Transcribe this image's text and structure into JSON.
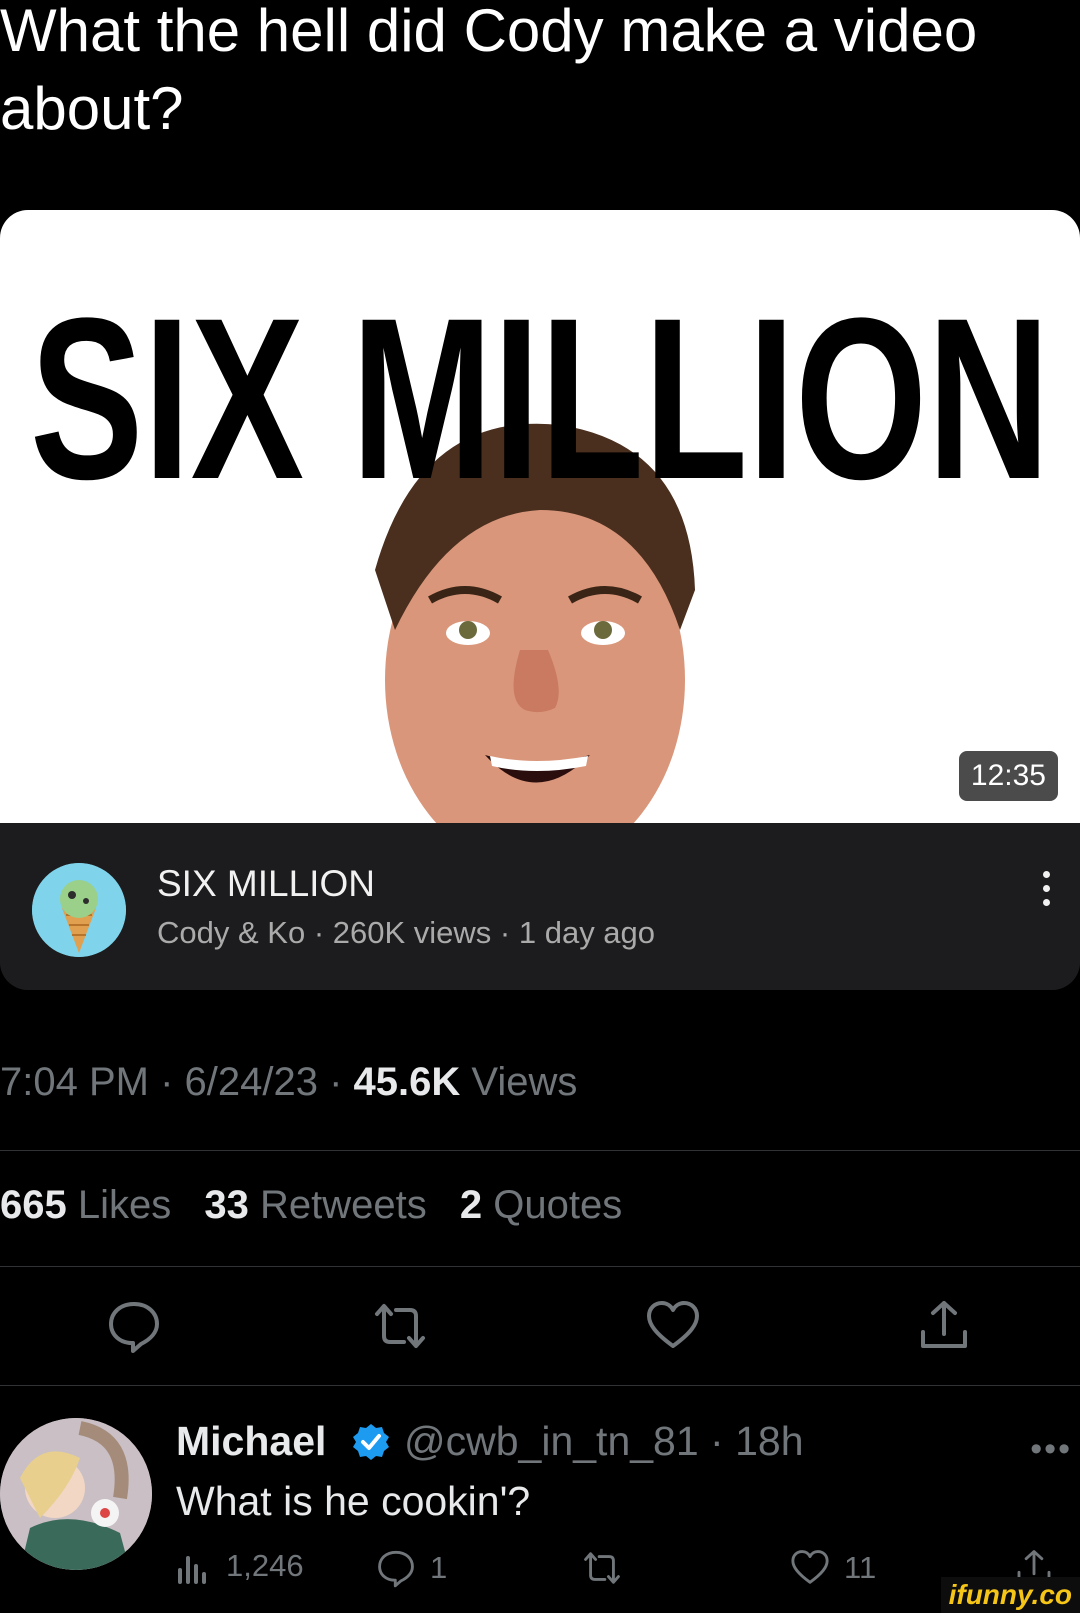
{
  "tweet": {
    "text": "What the hell did Cody make a video about?"
  },
  "video_card": {
    "thumbnail_headline": "SIX MILLION",
    "duration": "12:35",
    "title": "SIX MILLION",
    "channel": "Cody & Ko",
    "views": "260K views",
    "age": "1 day ago",
    "meta_separator": " · "
  },
  "tweet_meta": {
    "time": "7:04 PM",
    "date": "6/24/23",
    "views_count": "45.6K",
    "views_label": "Views",
    "separator": " · "
  },
  "stats": {
    "likes_count": "665",
    "likes_label": "Likes",
    "retweets_count": "33",
    "retweets_label": "Retweets",
    "quotes_count": "2",
    "quotes_label": "Quotes"
  },
  "actions": {
    "icons": [
      "reply-icon",
      "retweet-icon",
      "like-icon",
      "share-icon"
    ]
  },
  "reply": {
    "name": "Michael",
    "handle": "@cwb_in_tn_81",
    "age": "18h",
    "text": "What is he cookin'?",
    "views": "1,246",
    "replies": "1",
    "likes": "11",
    "more": "•••"
  },
  "watermark": "ifunny.co",
  "colors": {
    "background": "#000000",
    "card": "#1c1c1e",
    "muted_text": "#71767b",
    "verified_blue": "#1d9bf0",
    "watermark": "#f5c518"
  }
}
